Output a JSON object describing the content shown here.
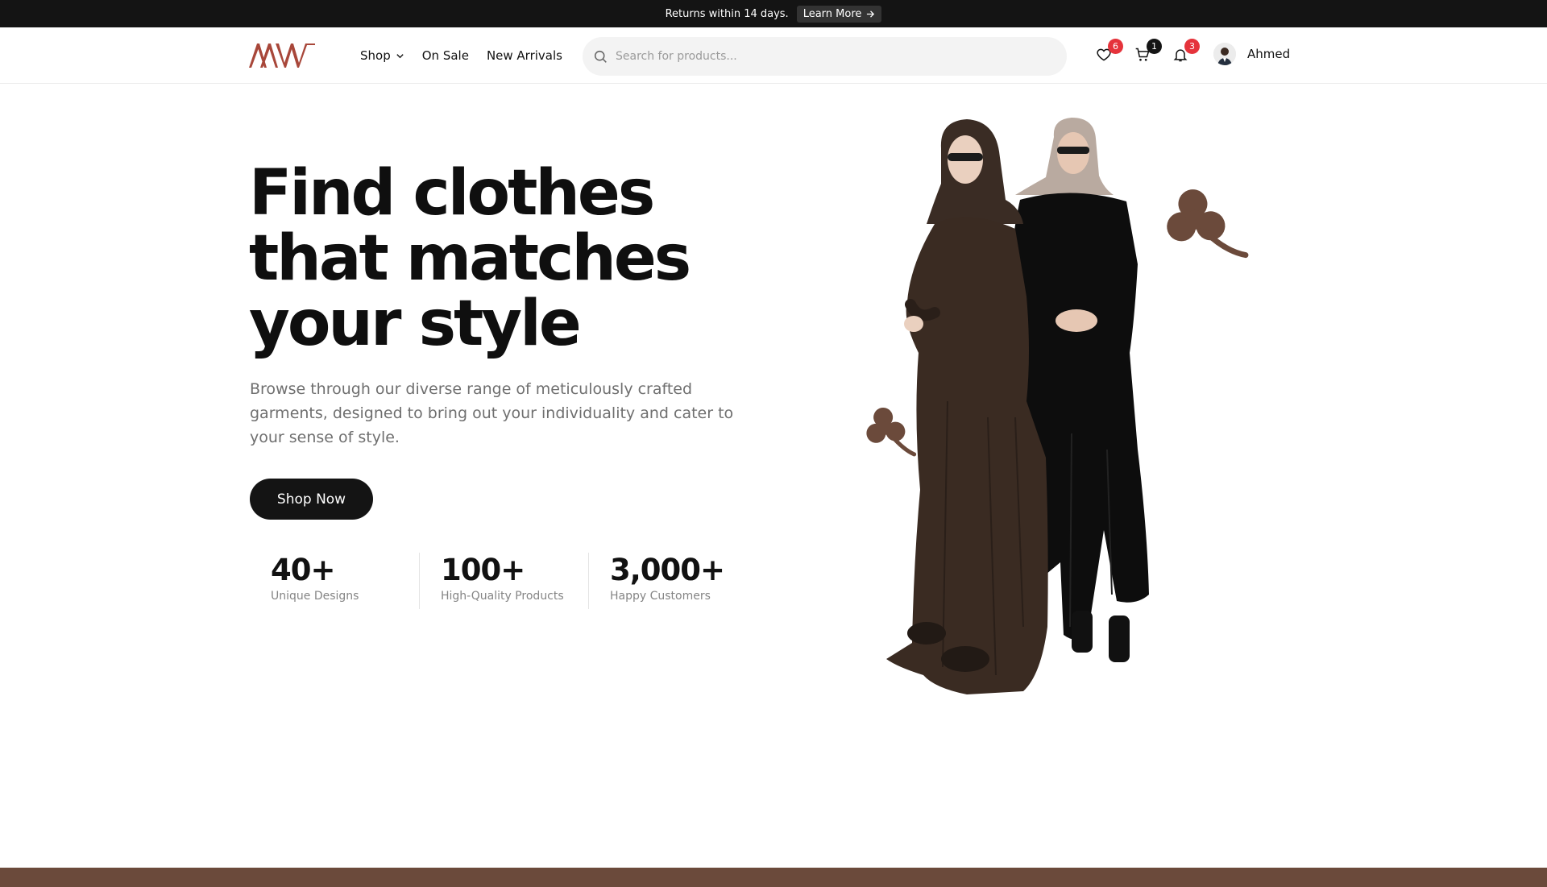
{
  "announcement": {
    "message": "Returns within 14 days.",
    "link_label": "Learn More"
  },
  "header": {
    "logo_text": "AW",
    "nav": [
      {
        "label": "Shop",
        "has_dropdown": true
      },
      {
        "label": "On Sale"
      },
      {
        "label": "New Arrivals"
      }
    ],
    "search": {
      "placeholder": "Search for products..."
    },
    "wishlist_count": "6",
    "cart_count": "1",
    "notifications_count": "3",
    "user_name": "Ahmed"
  },
  "hero": {
    "title": "Find clothes that matches your style",
    "subtitle": "Browse through our diverse range of meticulously crafted garments, designed to bring out your individuality and cater to your sense of style.",
    "cta_label": "Shop Now",
    "stats": [
      {
        "value": "40+",
        "label": "Unique Designs"
      },
      {
        "value": "100+",
        "label": "High-Quality Products"
      },
      {
        "value": "3,000+",
        "label": "Happy Customers"
      }
    ]
  },
  "colors": {
    "brand": "#a8473a",
    "dark": "#141414",
    "accent_brown": "#6b4a3b",
    "badge_red": "#e5333b",
    "badge_black": "#141414"
  },
  "icons": [
    "arrow-right-icon",
    "chevron-down-icon",
    "search-icon",
    "heart-icon",
    "cart-icon",
    "bell-icon",
    "clover-icon"
  ]
}
